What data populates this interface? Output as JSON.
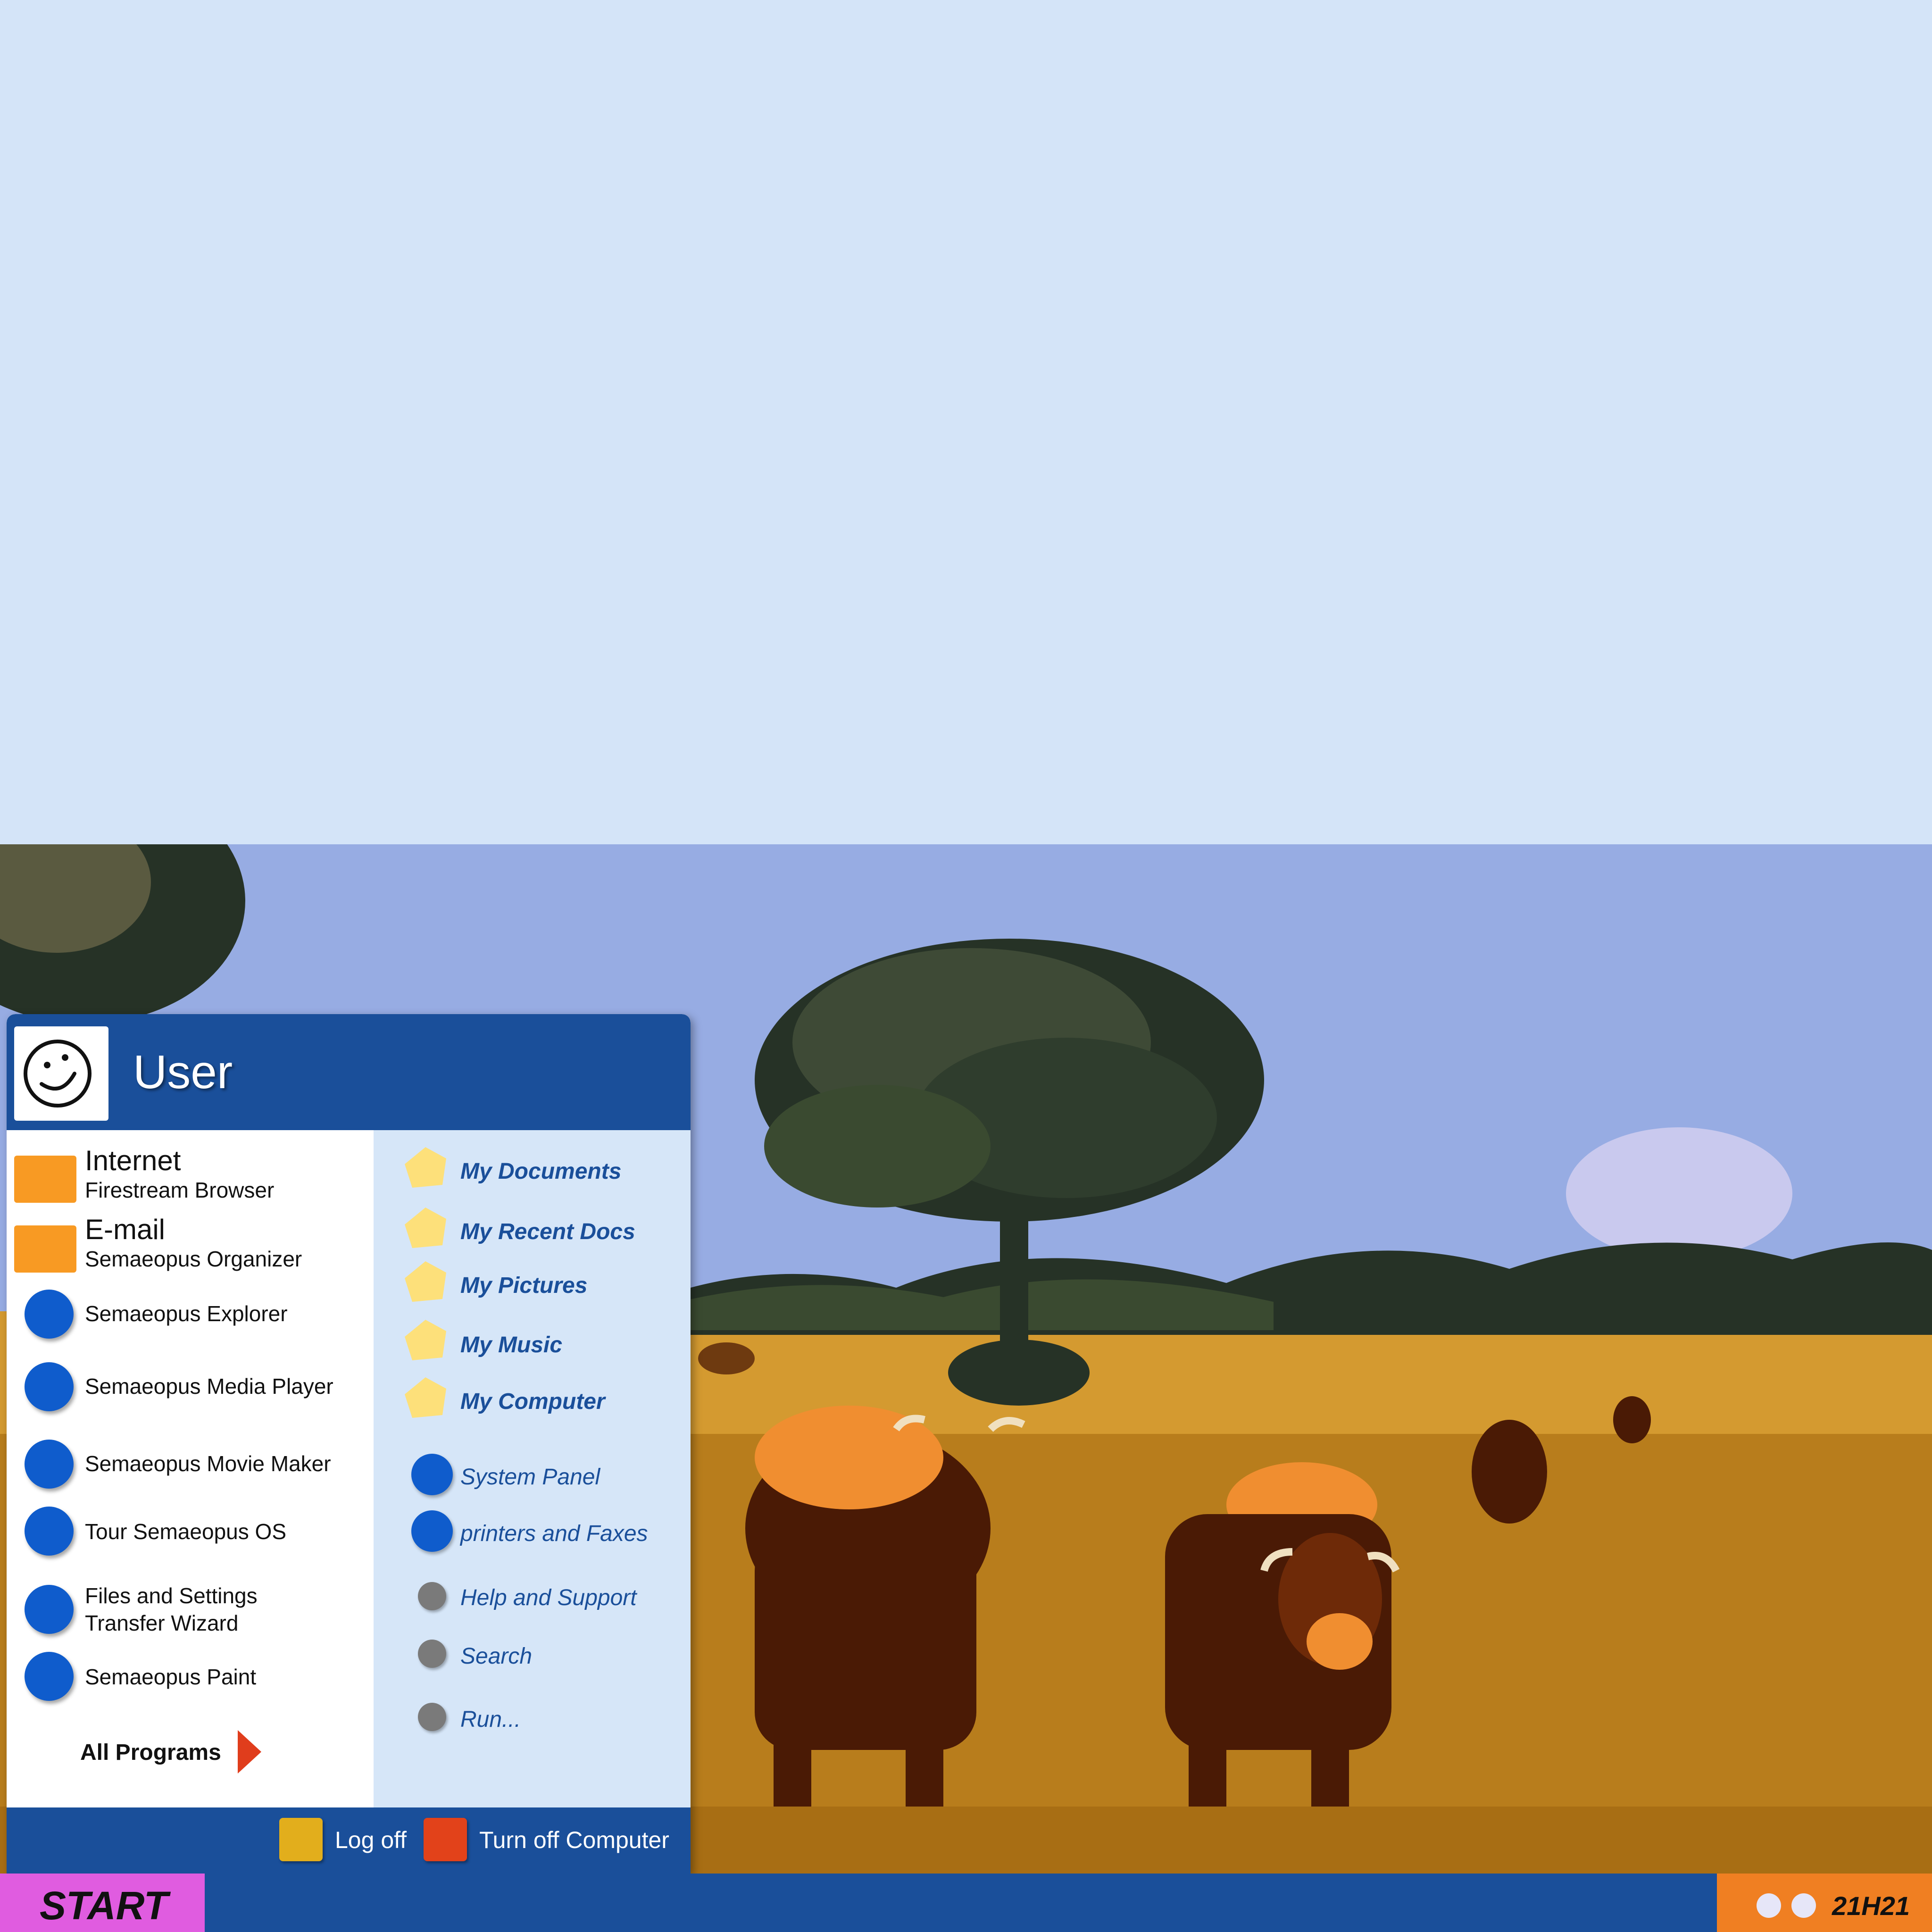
{
  "desktop": {
    "wallpaper": "cattle-grazing-under-oak-tree"
  },
  "start_menu": {
    "user_name": "User",
    "avatar_icon": "smiley-face-icon",
    "pinned": [
      {
        "title": "Internet",
        "subtitle": "Firestream Browser",
        "icon": "browser-icon"
      },
      {
        "title": "E-mail",
        "subtitle": "Semaeopus  Organizer",
        "icon": "mail-icon"
      }
    ],
    "programs": [
      {
        "label": "Semaeopus  Explorer"
      },
      {
        "label": "Semaeopus Media Player"
      },
      {
        "label": "Semaeopus Movie Maker"
      },
      {
        "label": "Tour Semaeopus OS"
      },
      {
        "label": "Files and Settings\nTransfer Wizard"
      },
      {
        "label": "Semaeopus Paint"
      }
    ],
    "all_programs": "All Programs",
    "places": [
      {
        "label": "My Documents"
      },
      {
        "label": "My Recent Docs"
      },
      {
        "label": "My Pictures"
      },
      {
        "label": "My Music"
      },
      {
        "label": "My Computer"
      }
    ],
    "system": [
      {
        "label": "System Panel"
      },
      {
        "label": "printers and Faxes"
      }
    ],
    "tools": [
      {
        "label": "Help and Support"
      },
      {
        "label": "Search"
      },
      {
        "label": "Run..."
      }
    ],
    "log_off": "Log off",
    "turn_off": "Turn off Computer"
  },
  "taskbar": {
    "start_label": "START",
    "clock": "21H21"
  },
  "colors": {
    "menu_blue": "#1a4f9a",
    "start_pink": "#e05ce0",
    "tray_orange": "#f07f22",
    "icon_orange": "#f89a23",
    "icon_blue": "#0f5ccc"
  }
}
